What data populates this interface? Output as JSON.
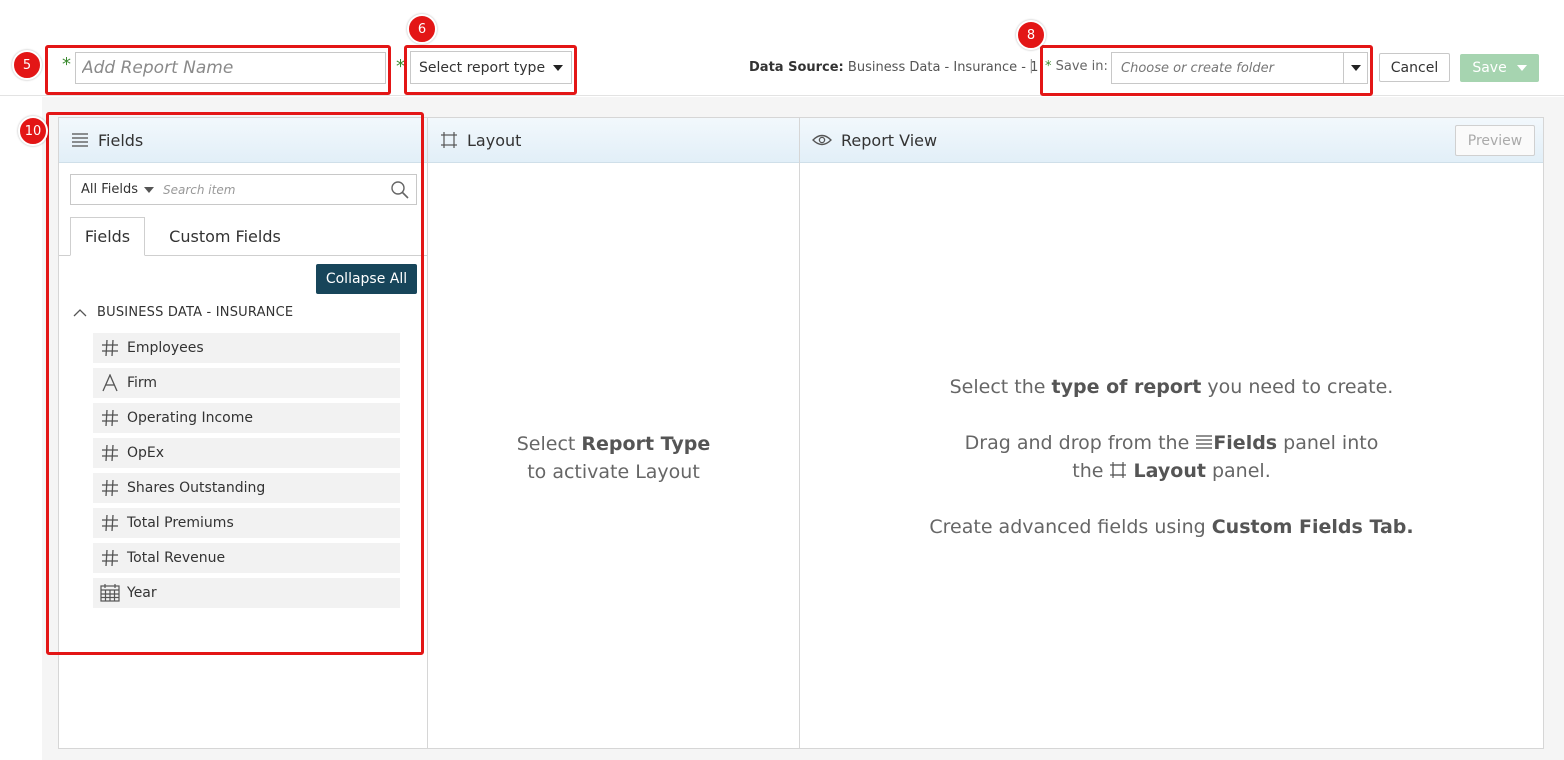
{
  "toolbar": {
    "required_mark": "*",
    "report_name_placeholder": "Add Report Name",
    "report_type_label": "Select report type",
    "data_source_label": "Data Source:",
    "data_source_value": "Business Data - Insurance - 1",
    "separator": "|",
    "save_in_label": "Save in:",
    "folder_placeholder": "Choose or create folder",
    "cancel_label": "Cancel",
    "save_label": "Save"
  },
  "annotations": {
    "badge_report_name": "5",
    "badge_report_type": "6",
    "badge_save_in": "8",
    "badge_fields_panel": "10",
    "color": "#e31616"
  },
  "fields_panel": {
    "title": "Fields",
    "filter_label": "All Fields",
    "search_placeholder": "Search item",
    "tabs": [
      {
        "label": "Fields",
        "active": true
      },
      {
        "label": "Custom Fields",
        "active": false
      }
    ],
    "collapse_label": "Collapse All",
    "group_title": "BUSINESS DATA - INSURANCE",
    "items": [
      {
        "label": "Employees",
        "icon": "number-icon"
      },
      {
        "label": "Firm",
        "icon": "text-icon"
      },
      {
        "label": "Operating Income",
        "icon": "number-icon"
      },
      {
        "label": "OpEx",
        "icon": "number-icon"
      },
      {
        "label": "Shares Outstanding",
        "icon": "number-icon"
      },
      {
        "label": "Total Premiums",
        "icon": "number-icon"
      },
      {
        "label": "Total Revenue",
        "icon": "number-icon"
      },
      {
        "label": "Year",
        "icon": "calendar-icon"
      }
    ]
  },
  "layout_panel": {
    "title": "Layout",
    "msg_prefix": "Select ",
    "msg_bold": "Report Type",
    "msg_line2": "to activate Layout"
  },
  "view_panel": {
    "title": "Report View",
    "preview_label": "Preview",
    "line1_prefix": "Select the ",
    "line1_bold": "type of report",
    "line1_suffix": " you need to create.",
    "line2_prefix": "Drag and drop from the ",
    "line2_bold": "Fields",
    "line2_suffix": " panel into",
    "line3_prefix": "the ",
    "line3_bold": "Layout",
    "line3_suffix": " panel.",
    "line4_prefix": "Create advanced fields using ",
    "line4_bold": "Custom Fields Tab."
  },
  "colors": {
    "primary_button": "#17455a",
    "save_disabled": "#a6d4b0",
    "required_star": "#3a8a2e",
    "panel_header": "#e2eff8"
  }
}
